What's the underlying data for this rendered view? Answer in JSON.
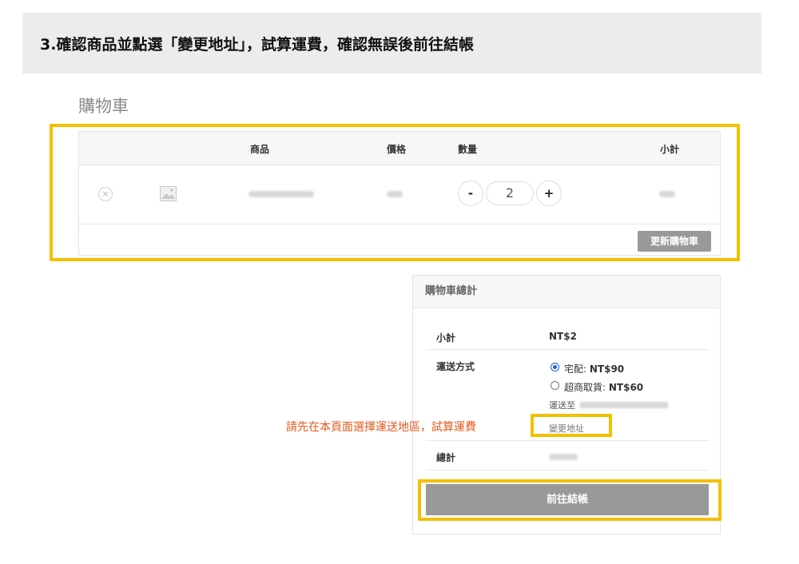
{
  "banner": {
    "step_title": "3.確認商品並點選「變更地址」，試算運費，確認無誤後前往結帳"
  },
  "cart": {
    "title": "購物車",
    "columns": [
      "商品",
      "價格",
      "數量",
      "小計"
    ],
    "row": {
      "quantity": "2",
      "minus": "-",
      "plus": "+",
      "remove": "×"
    },
    "update_button": "更新購物車"
  },
  "totals": {
    "title": "購物車總計",
    "subtotal_label": "小計",
    "subtotal_value": "NT$2",
    "shipping_label": "運送方式",
    "options": [
      {
        "name": "宅配:",
        "price": "NT$90",
        "selected": true
      },
      {
        "name": "超商取貨:",
        "price": "NT$60",
        "selected": false
      }
    ],
    "ship_to_prefix": "運送至",
    "change_address": "變更地址",
    "total_label": "總計",
    "checkout_button": "前往結帳"
  },
  "annotation": {
    "note": "請先在本頁面選擇運送地區，試算運費"
  },
  "colors": {
    "highlight": "#f3bf00",
    "note": "#e2591c",
    "radio": "#1a5fd6"
  }
}
